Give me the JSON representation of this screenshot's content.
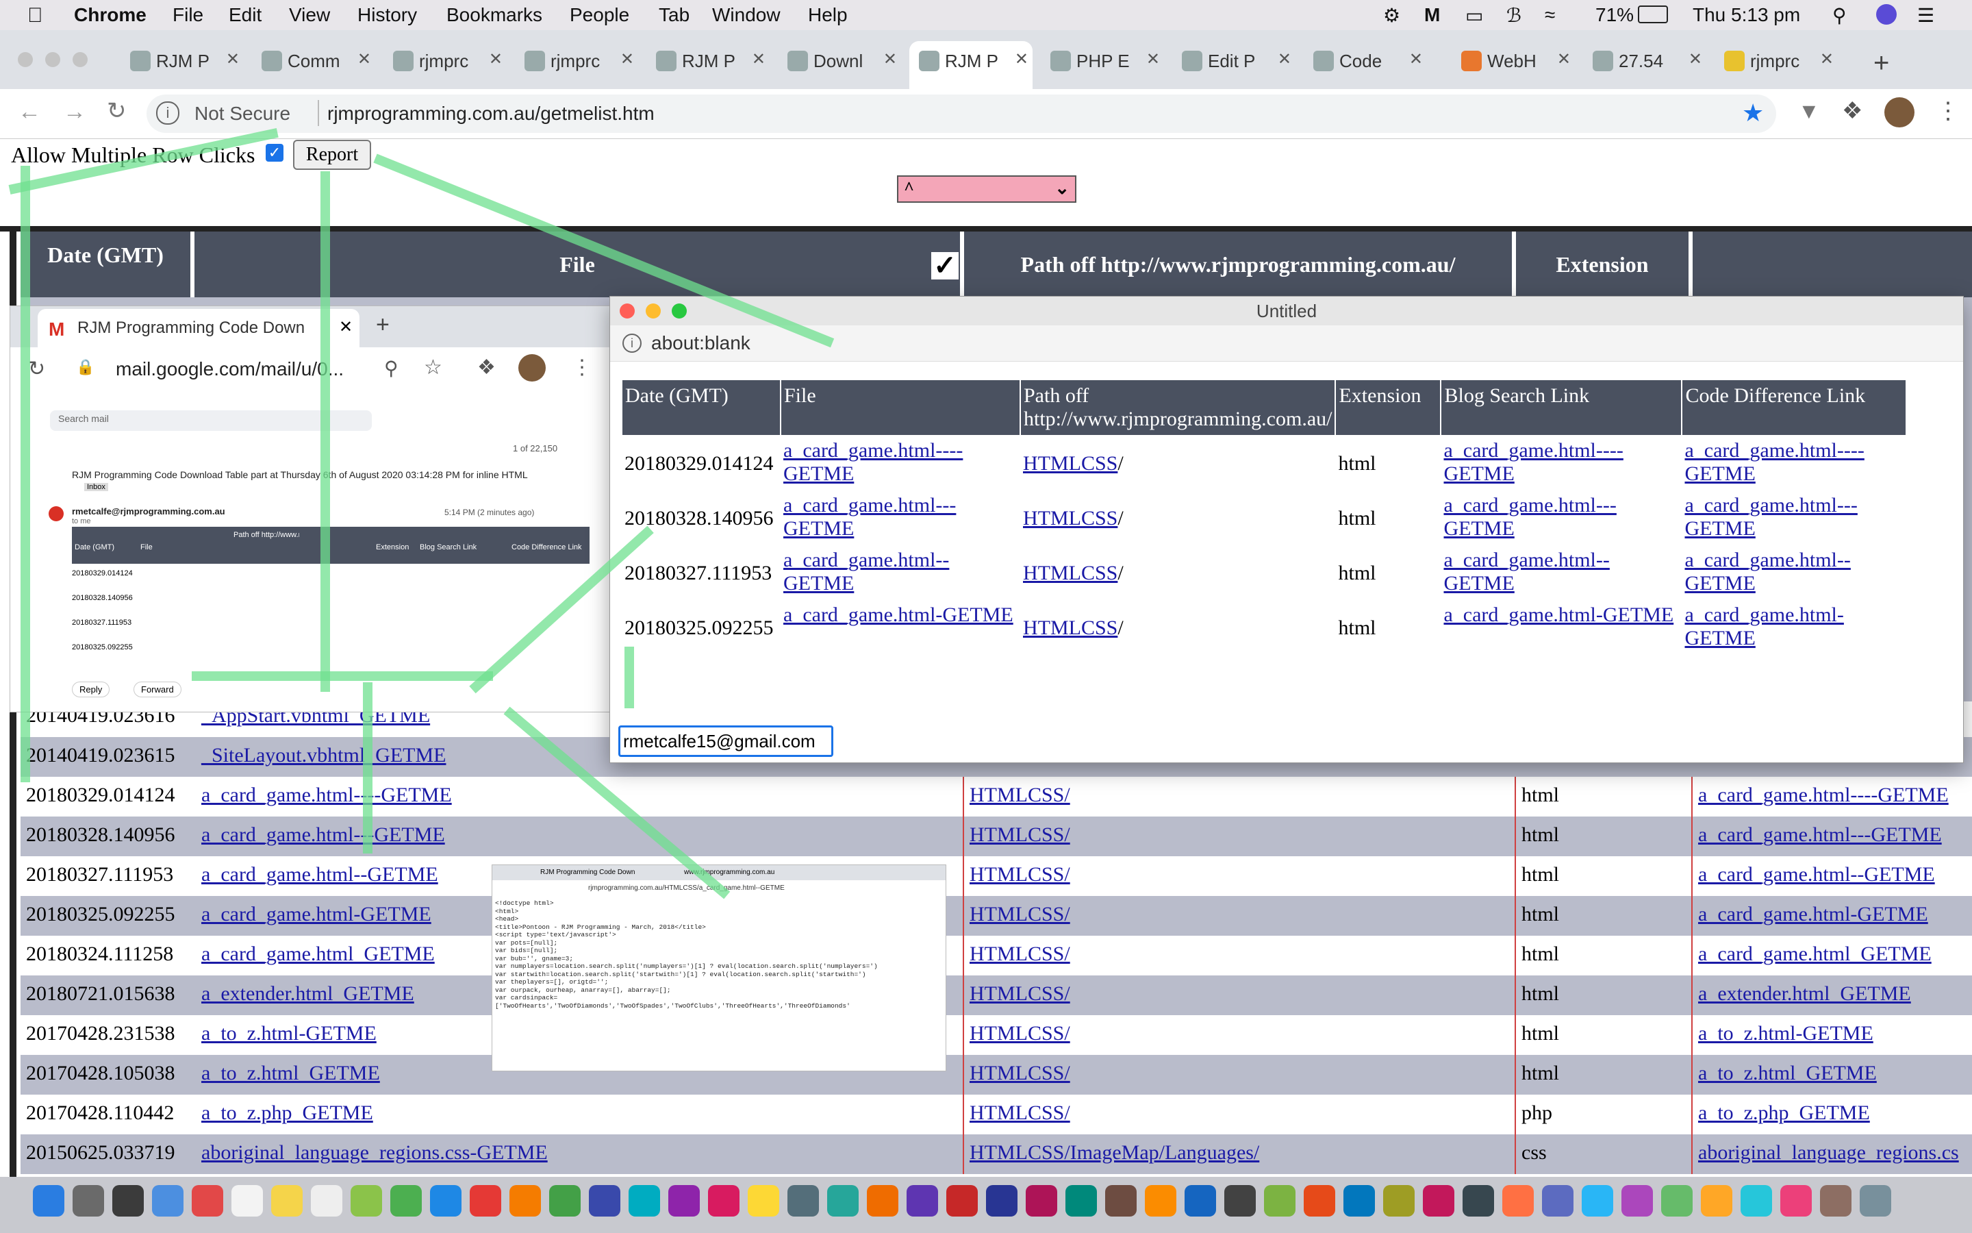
{
  "menubar": {
    "app": "Chrome",
    "items": [
      "File",
      "Edit",
      "View",
      "History",
      "Bookmarks",
      "People",
      "Tab",
      "Window",
      "Help"
    ],
    "battery": "71%",
    "clock": "Thu 5:13 pm"
  },
  "tabs": [
    {
      "label": "RJM P"
    },
    {
      "label": "Comm"
    },
    {
      "label": "rjmprc"
    },
    {
      "label": "rjmprc"
    },
    {
      "label": "RJM P"
    },
    {
      "label": "Downl"
    },
    {
      "label": "RJM P",
      "active": true
    },
    {
      "label": "PHP E"
    },
    {
      "label": "Edit P"
    },
    {
      "label": "Code"
    },
    {
      "label": "WebH"
    },
    {
      "label": "27.54"
    },
    {
      "label": "rjmprc"
    }
  ],
  "toolbar": {
    "security": "Not Secure",
    "url": "rjmprogramming.com.au/getmelist.htm"
  },
  "page": {
    "allow_label": "Allow Multiple Row Clicks",
    "report_button": "Report",
    "select_value": "^",
    "headers": {
      "date": "Date (GMT)",
      "file": "File",
      "path": "Path off http://www.rjmprogramming.com.au/",
      "ext": "Extension"
    },
    "rows": [
      {
        "date": "20140419.023616",
        "file": "_AppStart.vbhtml_GETME",
        "path": "",
        "ext": "",
        "code": ""
      },
      {
        "date": "20140419.023615",
        "file": "_SiteLayout.vbhtml_GETME",
        "path": "",
        "ext": "",
        "code": ""
      },
      {
        "date": "20180329.014124",
        "file": "a_card_game.html----GETME",
        "path": "HTMLCSS/",
        "ext": "html",
        "code": "a_card_game.html----GETME"
      },
      {
        "date": "20180328.140956",
        "file": "a_card_game.html---GETME",
        "path": "HTMLCSS/",
        "ext": "html",
        "code": "a_card_game.html---GETME"
      },
      {
        "date": "20180327.111953",
        "file": "a_card_game.html--GETME",
        "path": "HTMLCSS/",
        "ext": "html",
        "code": "a_card_game.html--GETME"
      },
      {
        "date": "20180325.092255",
        "file": "a_card_game.html-GETME",
        "path": "HTMLCSS/",
        "ext": "html",
        "code": "a_card_game.html-GETME"
      },
      {
        "date": "20180324.111258",
        "file": "a_card_game.html_GETME",
        "path": "HTMLCSS/",
        "ext": "html",
        "code": "a_card_game.html_GETME"
      },
      {
        "date": "20180721.015638",
        "file": "a_extender.html_GETME",
        "path": "HTMLCSS/",
        "ext": "html",
        "code": "a_extender.html_GETME"
      },
      {
        "date": "20170428.231538",
        "file": "a_to_z.html-GETME",
        "path": "HTMLCSS/",
        "ext": "html",
        "code": "a_to_z.html-GETME"
      },
      {
        "date": "20170428.105038",
        "file": "a_to_z.html_GETME",
        "path": "HTMLCSS/",
        "ext": "html",
        "code": "a_to_z.html_GETME"
      },
      {
        "date": "20170428.110442",
        "file": "a_to_z.php_GETME",
        "path": "HTMLCSS/",
        "ext": "php",
        "code": "a_to_z.php_GETME"
      },
      {
        "date": "20150625.033719",
        "file": "aboriginal_language_regions.css-GETME",
        "path": "HTMLCSS/ImageMap/Languages/",
        "ext": "css",
        "code": "aboriginal_language_regions.cs"
      }
    ]
  },
  "popup": {
    "title": "Untitled",
    "url": "about:blank",
    "headers": {
      "date": "Date (GMT)",
      "file": "File",
      "path": "Path off http://www.rjmprogramming.com.au/",
      "ext": "Extension",
      "blog": "Blog Search Link",
      "code": "Code Difference Link"
    },
    "rows": [
      {
        "date": "20180329.014124",
        "file": "a_card_game.html----GETME",
        "path": "HTMLCSS",
        "ext": "html"
      },
      {
        "date": "20180328.140956",
        "file": "a_card_game.html---GETME",
        "path": "HTMLCSS",
        "ext": "html"
      },
      {
        "date": "20180327.111953",
        "file": "a_card_game.html--GETME",
        "path": "HTMLCSS",
        "ext": "html"
      },
      {
        "date": "20180325.092255",
        "file": "a_card_game.html-GETME",
        "path": "HTMLCSS",
        "ext": "html"
      }
    ],
    "email_value": "rmetcalfe15@gmail.com"
  },
  "gmail": {
    "tab_title": "RJM Programming Code Down",
    "url": "mail.google.com/mail/u/0...",
    "search_placeholder": "Search mail",
    "count": "1 of 22,150",
    "subject": "RJM Programming Code Download Table part at Thursday 6th of August 2020 03:14:28 PM for inline HTML",
    "inbox_badge": "Inbox",
    "sender": "rmetcalfe@rjmprogramming.com.au",
    "to": "to me",
    "time": "5:14 PM (2 minutes ago)",
    "reply": "Reply",
    "forward": "Forward"
  },
  "code_thumb": {
    "tab1": "RJM Programming Code Down",
    "tab2": "www.rjmprogramming.com.au",
    "url": "rjmprogramming.com.au/HTMLCSS/a_card_game.html--GETME",
    "lines": [
      "<!doctype html>",
      "<html>",
      "<head>",
      "<title>Pontoon - RJM Programming - March, 2018</title>",
      "<script type='text/javascript'>",
      "var pots=[null];",
      "var bids=[null];",
      "var bub='', gname=3;",
      "var numplayers=location.search.split('numplayers=')[1] ? eval(location.search.split('numplayers=')",
      "var startwith=location.search.split('startwith=')[1] ? eval(location.search.split('startwith=')",
      "var theplayers=[], origtd='';",
      "var ourpack, ourheap, anarray=[], abarray=[];",
      "var cardsinpack=",
      "['TwoOfHearts','TwoOfDiamonds','TwoOfSpades','TwoOfClubs','ThreeOfHearts','ThreeOfDiamonds'"
    ]
  },
  "colors": {
    "header": "#4a5160",
    "alt_row": "#b9bccb",
    "link": "#1a1aa6",
    "annotation": "#6fe08f",
    "select": "#f4a6b8"
  }
}
